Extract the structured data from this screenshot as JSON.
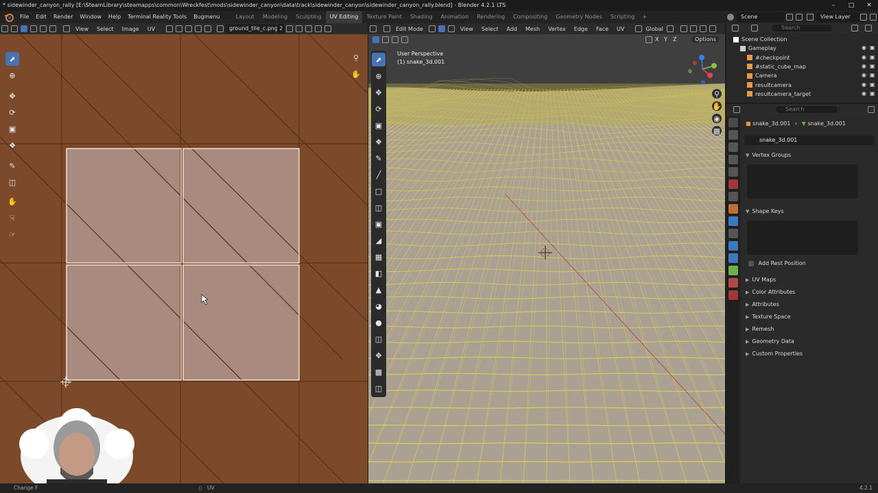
{
  "title": "* sidewinder_canyon_rally [E:\\SteamLibrary\\steamapps\\common\\Wreckfest\\mods\\sidewinder_canyon\\data\\track\\sidewinder_canyon\\sidewinder_canyon_rally.blend] - Blender 4.2.1 LTS",
  "menu": [
    "File",
    "Edit",
    "Render",
    "Window",
    "Help",
    "Terminal Reality Tools",
    "Bugmenu"
  ],
  "workspaces": [
    {
      "label": "Layout",
      "active": false
    },
    {
      "label": "Modeling",
      "active": false
    },
    {
      "label": "Sculpting",
      "active": false
    },
    {
      "label": "UV Editing",
      "active": true
    },
    {
      "label": "Texture Paint",
      "active": false
    },
    {
      "label": "Shading",
      "active": false
    },
    {
      "label": "Animation",
      "active": false
    },
    {
      "label": "Rendering",
      "active": false
    },
    {
      "label": "Compositing",
      "active": false
    },
    {
      "label": "Geometry Nodes",
      "active": false
    },
    {
      "label": "Scripting",
      "active": false
    }
  ],
  "scene": {
    "name": "Scene",
    "view_layer": "View Layer"
  },
  "uv_editor": {
    "menus": [
      "View",
      "Select",
      "Image",
      "UV"
    ],
    "image_name": "ground_tile_c.png",
    "image_users": "2"
  },
  "viewport": {
    "mode": "Edit Mode",
    "menus": [
      "View",
      "Select",
      "Add",
      "Mesh",
      "Vertex",
      "Edge",
      "Face",
      "UV"
    ],
    "orientation": "Global",
    "perspective_label": "User Perspective",
    "object_label": "(1) snake_3d.001",
    "options_label": "Options",
    "axes": [
      "X",
      "Y",
      "Z"
    ]
  },
  "outliner": {
    "search_placeholder": "Search",
    "rows": [
      {
        "label": "Scene Collection",
        "indent": 0
      },
      {
        "label": "Gameplay",
        "indent": 1
      },
      {
        "label": "#checkpoint",
        "indent": 2
      },
      {
        "label": "#static_cube_map",
        "indent": 2
      },
      {
        "label": "Camera",
        "indent": 2
      },
      {
        "label": "resultcamera",
        "indent": 2
      },
      {
        "label": "resultcamera_target",
        "indent": 2
      }
    ]
  },
  "properties": {
    "search_placeholder": "Search",
    "breadcrumb_object": "snake_3d.001",
    "breadcrumb_mesh": "snake_3d.001",
    "mesh_name": "snake_3d.001",
    "vertex_groups": "Vertex Groups",
    "shape_keys": "Shape Keys",
    "add_rest_position": "Add Rest Position",
    "panels": [
      "UV Maps",
      "Color Attributes",
      "Attributes",
      "Texture Space",
      "Remesh",
      "Geometry Data",
      "Custom Properties"
    ]
  },
  "statusbar": {
    "left": "Change F",
    "mid_icon_label": "UV",
    "version": "4.2.1"
  },
  "colors": {
    "uv_bg": "#7c4a2a",
    "uv_face": "#a88a7e",
    "wire": "#e0d050",
    "accent": "#4772b3",
    "active_tab": "#3a3a3a"
  }
}
